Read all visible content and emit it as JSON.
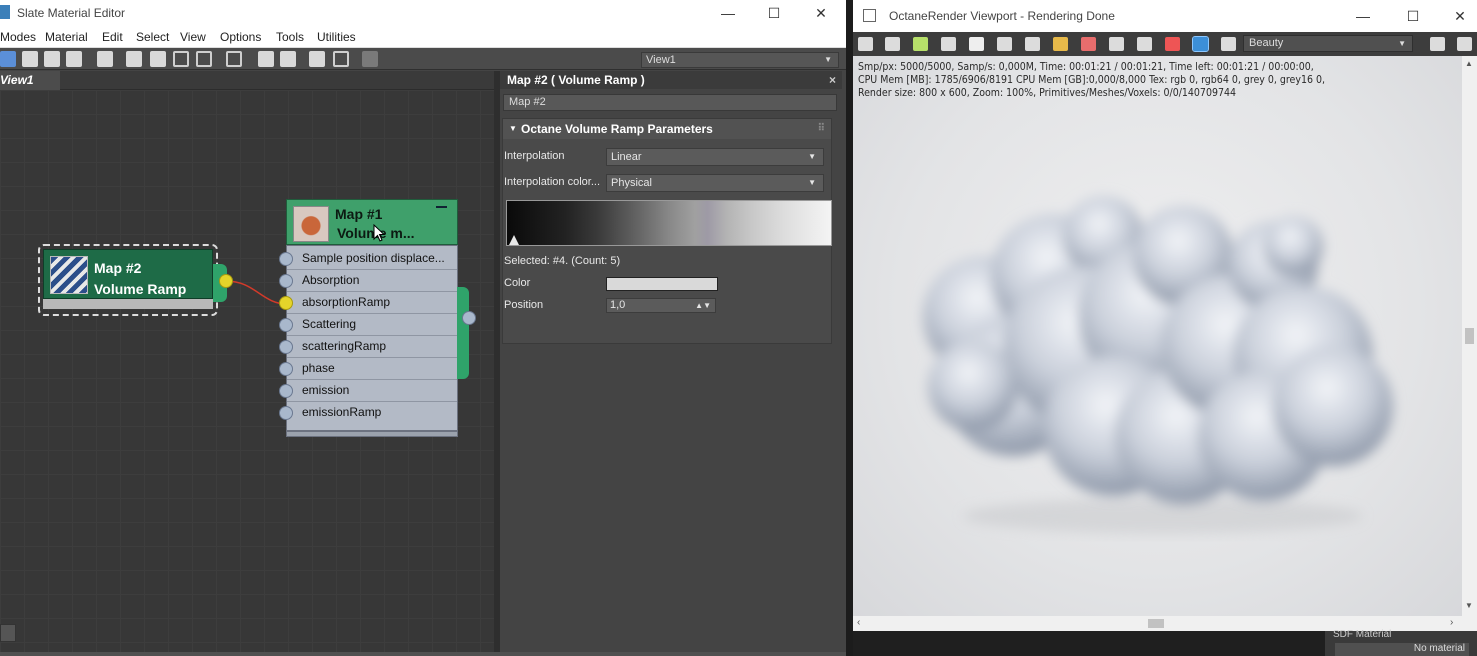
{
  "slate": {
    "title": "Slate Material Editor",
    "window_buttons": {
      "minimize": "—",
      "maximize": "☐",
      "close": "✕"
    },
    "menu": [
      "Modes",
      "Material",
      "Edit",
      "Select",
      "View",
      "Options",
      "Tools",
      "Utilities"
    ],
    "view_selector": "View1",
    "view_tab": "View1",
    "node_a": {
      "title": "Map #2",
      "subtitle": "Volume Ramp"
    },
    "node_b": {
      "title": "Map #1",
      "subtitle": "Volume m...",
      "slots": [
        "Sample position displace...",
        "Absorption",
        "absorptionRamp",
        "Scattering",
        "scatteringRamp",
        "phase",
        "emission",
        "emissionRamp"
      ]
    },
    "panel": {
      "header": "Map #2  ( Volume Ramp )",
      "close": "×",
      "map_name": "Map #2",
      "rollout_title": "Octane Volume Ramp Parameters",
      "interpolation_label": "Interpolation",
      "interpolation_value": "Linear",
      "interpolation_color_label": "Interpolation color...",
      "interpolation_color_value": "Physical",
      "selected_text": "Selected: #4. (Count: 5)",
      "color_label": "Color",
      "position_label": "Position",
      "position_value": "1,0"
    }
  },
  "octane": {
    "title": "OctaneRender Viewport - Rendering Done",
    "window_buttons": {
      "minimize": "—",
      "maximize": "☐",
      "close": "✕"
    },
    "pass_selector": "Beauty",
    "stats": [
      "Smp/px: 5000/5000,   Samp/s: 0,000M,   Time: 00:01:21 / 00:01:21,   Time left: 00:01:21 / 00:00:00,",
      "CPU Mem [MB]: 1785/6906/8191   CPU Mem [GB]:0,000/8,000   Tex: rgb 0, rgb64 0, grey 0, grey16 0,",
      "Render size: 800 x 600,   Zoom: 100%,   Primitives/Meshes/Voxels: 0/0/140709744"
    ],
    "bottom_material_label": "SDF Material",
    "bottom_material_value": "No material"
  },
  "colors": {
    "node_green_dark": "#1e6b47",
    "node_green": "#3fa06b",
    "port_yellow": "#e5d42a",
    "wire_red": "#d23a2a",
    "octane_active": "#3c8fd8"
  }
}
